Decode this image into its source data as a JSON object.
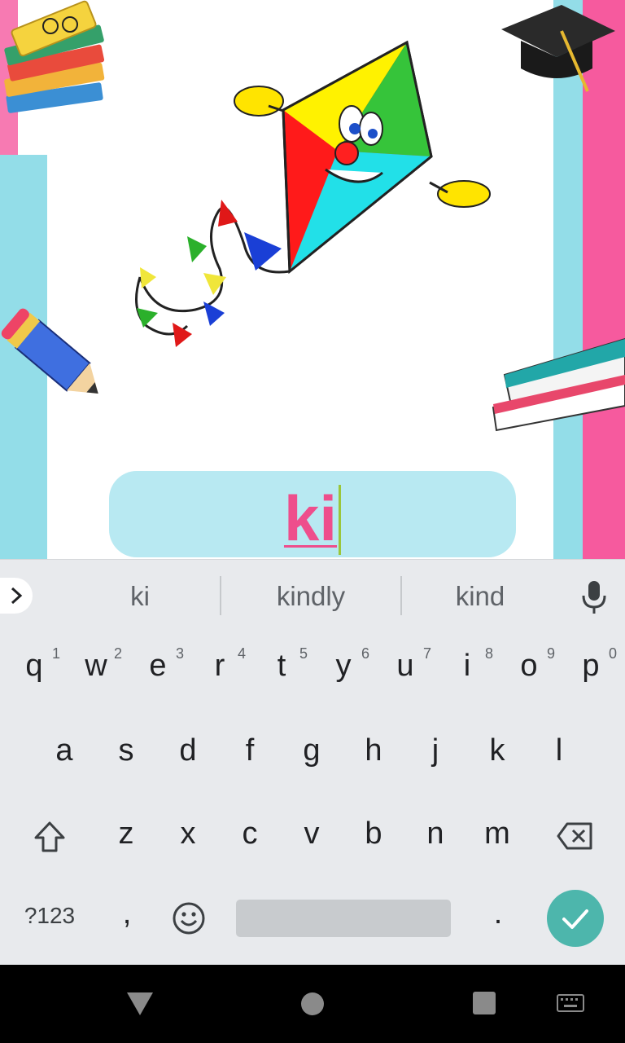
{
  "answer": {
    "text": "ki"
  },
  "suggestions": [
    "ki",
    "kindly",
    "kind"
  ],
  "keyboard": {
    "row1": [
      {
        "k": "q",
        "h": "1"
      },
      {
        "k": "w",
        "h": "2"
      },
      {
        "k": "e",
        "h": "3"
      },
      {
        "k": "r",
        "h": "4"
      },
      {
        "k": "t",
        "h": "5"
      },
      {
        "k": "y",
        "h": "6"
      },
      {
        "k": "u",
        "h": "7"
      },
      {
        "k": "i",
        "h": "8"
      },
      {
        "k": "o",
        "h": "9"
      },
      {
        "k": "p",
        "h": "0"
      }
    ],
    "row2": [
      "a",
      "s",
      "d",
      "f",
      "g",
      "h",
      "j",
      "k",
      "l"
    ],
    "row3": [
      "z",
      "x",
      "c",
      "v",
      "b",
      "n",
      "m"
    ],
    "symbols_label": "?123",
    "comma": ",",
    "period": "."
  },
  "colors": {
    "accent_pink": "#ee4e8c",
    "field_bg": "#b8e9f2",
    "enter_green": "#4db6ac"
  },
  "icons": [
    "kite-illustration",
    "books-icon",
    "graduation-cap-icon",
    "pencil-icon",
    "mic-icon",
    "shift-icon",
    "backspace-icon",
    "emoji-icon",
    "check-icon",
    "back-nav-icon",
    "home-nav-icon",
    "recents-nav-icon",
    "keyboard-switch-icon"
  ]
}
